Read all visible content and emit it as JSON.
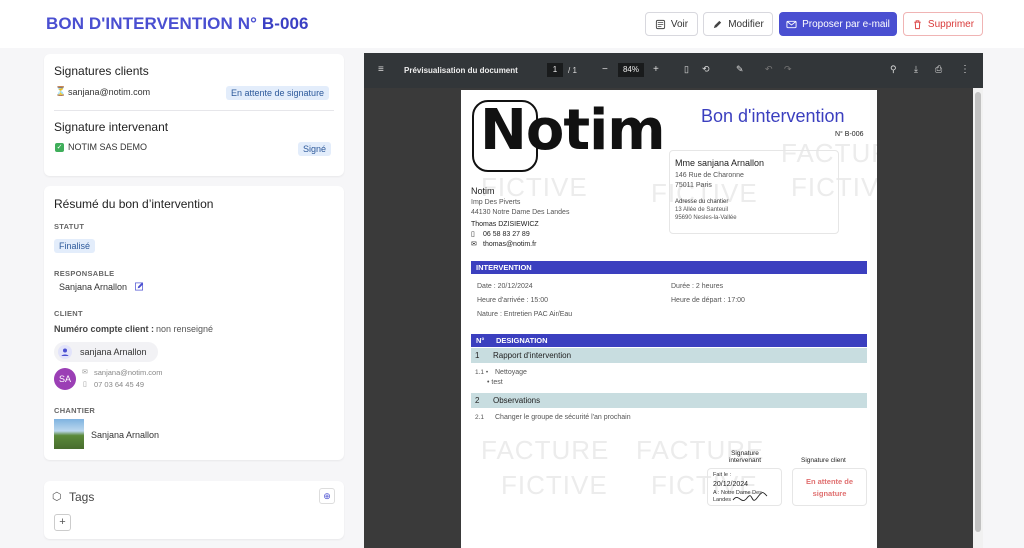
{
  "header": {
    "title_prefix": "BON D'INTERVENTION N°",
    "title_number": "B-006"
  },
  "toolbar": {
    "voir": "Voir",
    "modifier": "Modifier",
    "proposer": "Proposer par e-mail",
    "supprimer": "Supprimer"
  },
  "signatures": {
    "clients_title": "Signatures clients",
    "client_email": "sanjana@notim.com",
    "client_status": "En attente de signature",
    "intervenant_title": "Signature intervenant",
    "intervenant_name": "NOTIM SAS DEMO",
    "intervenant_status": "Signé"
  },
  "resume": {
    "title": "Résumé du bon d’intervention",
    "statut_label": "STATUT",
    "statut": "Finalisé",
    "responsable_label": "RESPONSABLE",
    "responsable": "Sanjana Arnallon",
    "client_label": "CLIENT",
    "compte_label": "Numéro compte client :",
    "compte_value": "non renseigné",
    "client_name": "sanjana Arnallon",
    "avatar": "SA",
    "client_email": "sanjana@notim.com",
    "client_phone": "07 03 64 45 49",
    "chantier_label": "CHANTIER",
    "chantier_name": "Sanjana Arnallon"
  },
  "tags": {
    "title": "Tags",
    "add": "+"
  },
  "viewer": {
    "title": "Prévisualisation du document",
    "page": "1",
    "pages": "/ 1",
    "zoom": "84%"
  },
  "doc": {
    "logo": "Notim",
    "heading": "Bon d'intervention",
    "number": "N° B-006",
    "client_name": "Mme sanjana Arnallon",
    "client_addr1": "146 Rue de Charonne",
    "client_addr2": "75011 Paris",
    "chantier_label": "Adresse du chantier",
    "chantier_addr1": "13 Allée de Santeuil",
    "chantier_addr2": "95690 Nesles-la-Vallée",
    "company": "Notim",
    "company_addr1": "Imp Des Piverts",
    "company_addr2": "44130 Notre Dame Des Landes",
    "contact": "Thomas DZISIEWICZ",
    "phone": "06 58 83 27 89",
    "email": "thomas@notim.fr",
    "intervention_label": "INTERVENTION",
    "date": "Date : 20/12/2024",
    "duree": "Durée : 2 heures",
    "arrivee": "Heure d'arrivée : 15:00",
    "depart": "Heure de départ : 17:00",
    "nature": "Nature : Entretien PAC Air/Eau",
    "col_no": "N°",
    "col_desig": "DESIGNATION",
    "s1_no": "1",
    "s1": "Rapport d'intervention",
    "i11_no": "1.1 •",
    "i11": "Nettoyage",
    "i11b": "• test",
    "s2_no": "2",
    "s2": "Observations",
    "i21_no": "2.1",
    "i21": "Changer le groupe de sécurité l'an prochain",
    "sig_int_title": "Signature intervenant",
    "sig_client_title": "Signature client",
    "fait_le": "Fait le :",
    "fait_date": "20/12/2024",
    "fait_lieu": "A : Notre Dame Des Landes",
    "sig_pending": "En attente de signature",
    "watermark_1": "FACTURE",
    "watermark_2": "FICTIVE"
  }
}
